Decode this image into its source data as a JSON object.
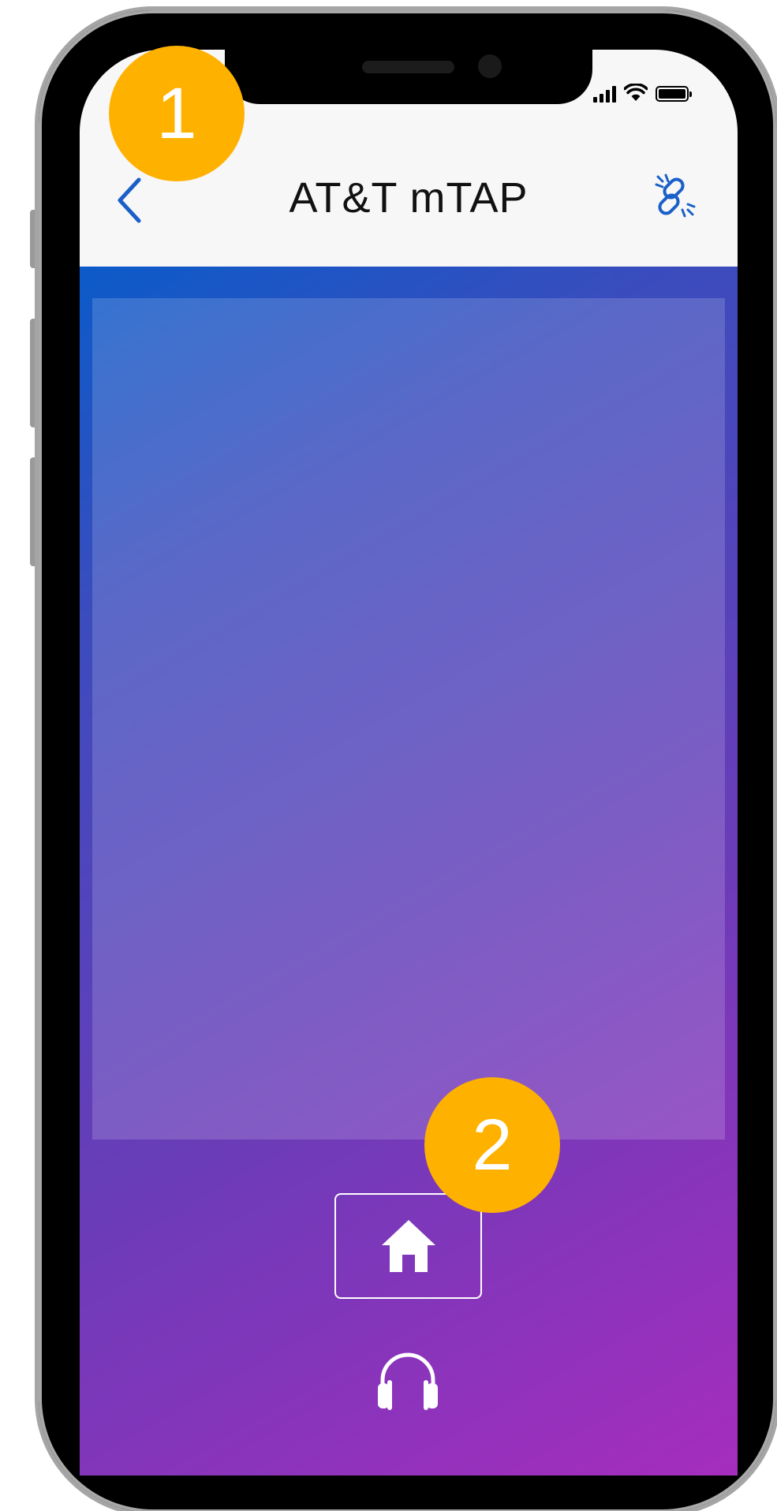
{
  "header": {
    "title": "AT&T mTAP",
    "back_icon": "chevron-left-icon",
    "link_icon": "broken-link-icon"
  },
  "status_bar": {
    "signal_icon": "cellular-signal-icon",
    "wifi_icon": "wifi-icon",
    "battery_icon": "battery-icon",
    "battery_level": 1.0
  },
  "navigation": {
    "home_icon": "home-icon",
    "support_icon": "headphones-icon"
  },
  "callouts": [
    {
      "label": "1"
    },
    {
      "label": "2"
    }
  ],
  "colors": {
    "accent": "#1a5fc8",
    "gradient_start": "#0b5bc9",
    "gradient_end": "#a62dbd",
    "callout": "#ffb100",
    "header_bg": "#f7f7f7"
  }
}
